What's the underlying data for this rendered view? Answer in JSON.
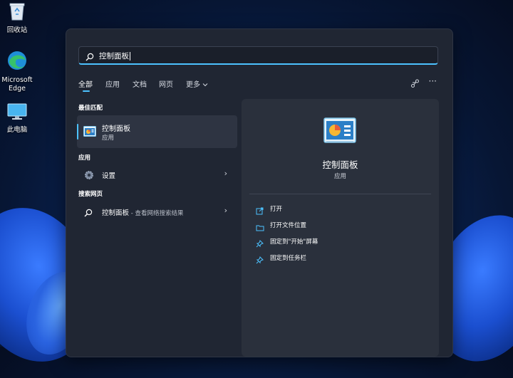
{
  "desktop": {
    "icons": [
      {
        "label": "回收站",
        "icon": "recycle-bin-icon"
      },
      {
        "label": "Microsoft Edge",
        "icon": "edge-icon"
      },
      {
        "label": "此电脑",
        "icon": "monitor-icon"
      }
    ]
  },
  "search": {
    "value": "控制面板"
  },
  "tabs": [
    {
      "label": "全部",
      "active": true
    },
    {
      "label": "应用"
    },
    {
      "label": "文档"
    },
    {
      "label": "网页"
    },
    {
      "label": "更多"
    }
  ],
  "sections": {
    "best_match": "最佳匹配",
    "apps": "应用",
    "web": "搜索网页"
  },
  "best_match": {
    "title": "控制面板",
    "subtitle": "应用",
    "icon": "control-panel-icon"
  },
  "apps": [
    {
      "label": "设置",
      "icon": "settings-gear-icon"
    }
  ],
  "web": {
    "query": "控制面板",
    "suffix": " - 查看网络搜索结果"
  },
  "preview": {
    "title": "控制面板",
    "subtitle": "应用",
    "actions": [
      {
        "label": "打开",
        "icon": "open-external-icon"
      },
      {
        "label": "打开文件位置",
        "icon": "folder-icon"
      },
      {
        "label": "固定到\"开始\"屏幕",
        "icon": "pin-icon"
      },
      {
        "label": "固定到任务栏",
        "icon": "pin-icon"
      }
    ]
  },
  "colors": {
    "accent": "#4cc2ff",
    "panel": "#202633",
    "preview": "#2a303c"
  }
}
